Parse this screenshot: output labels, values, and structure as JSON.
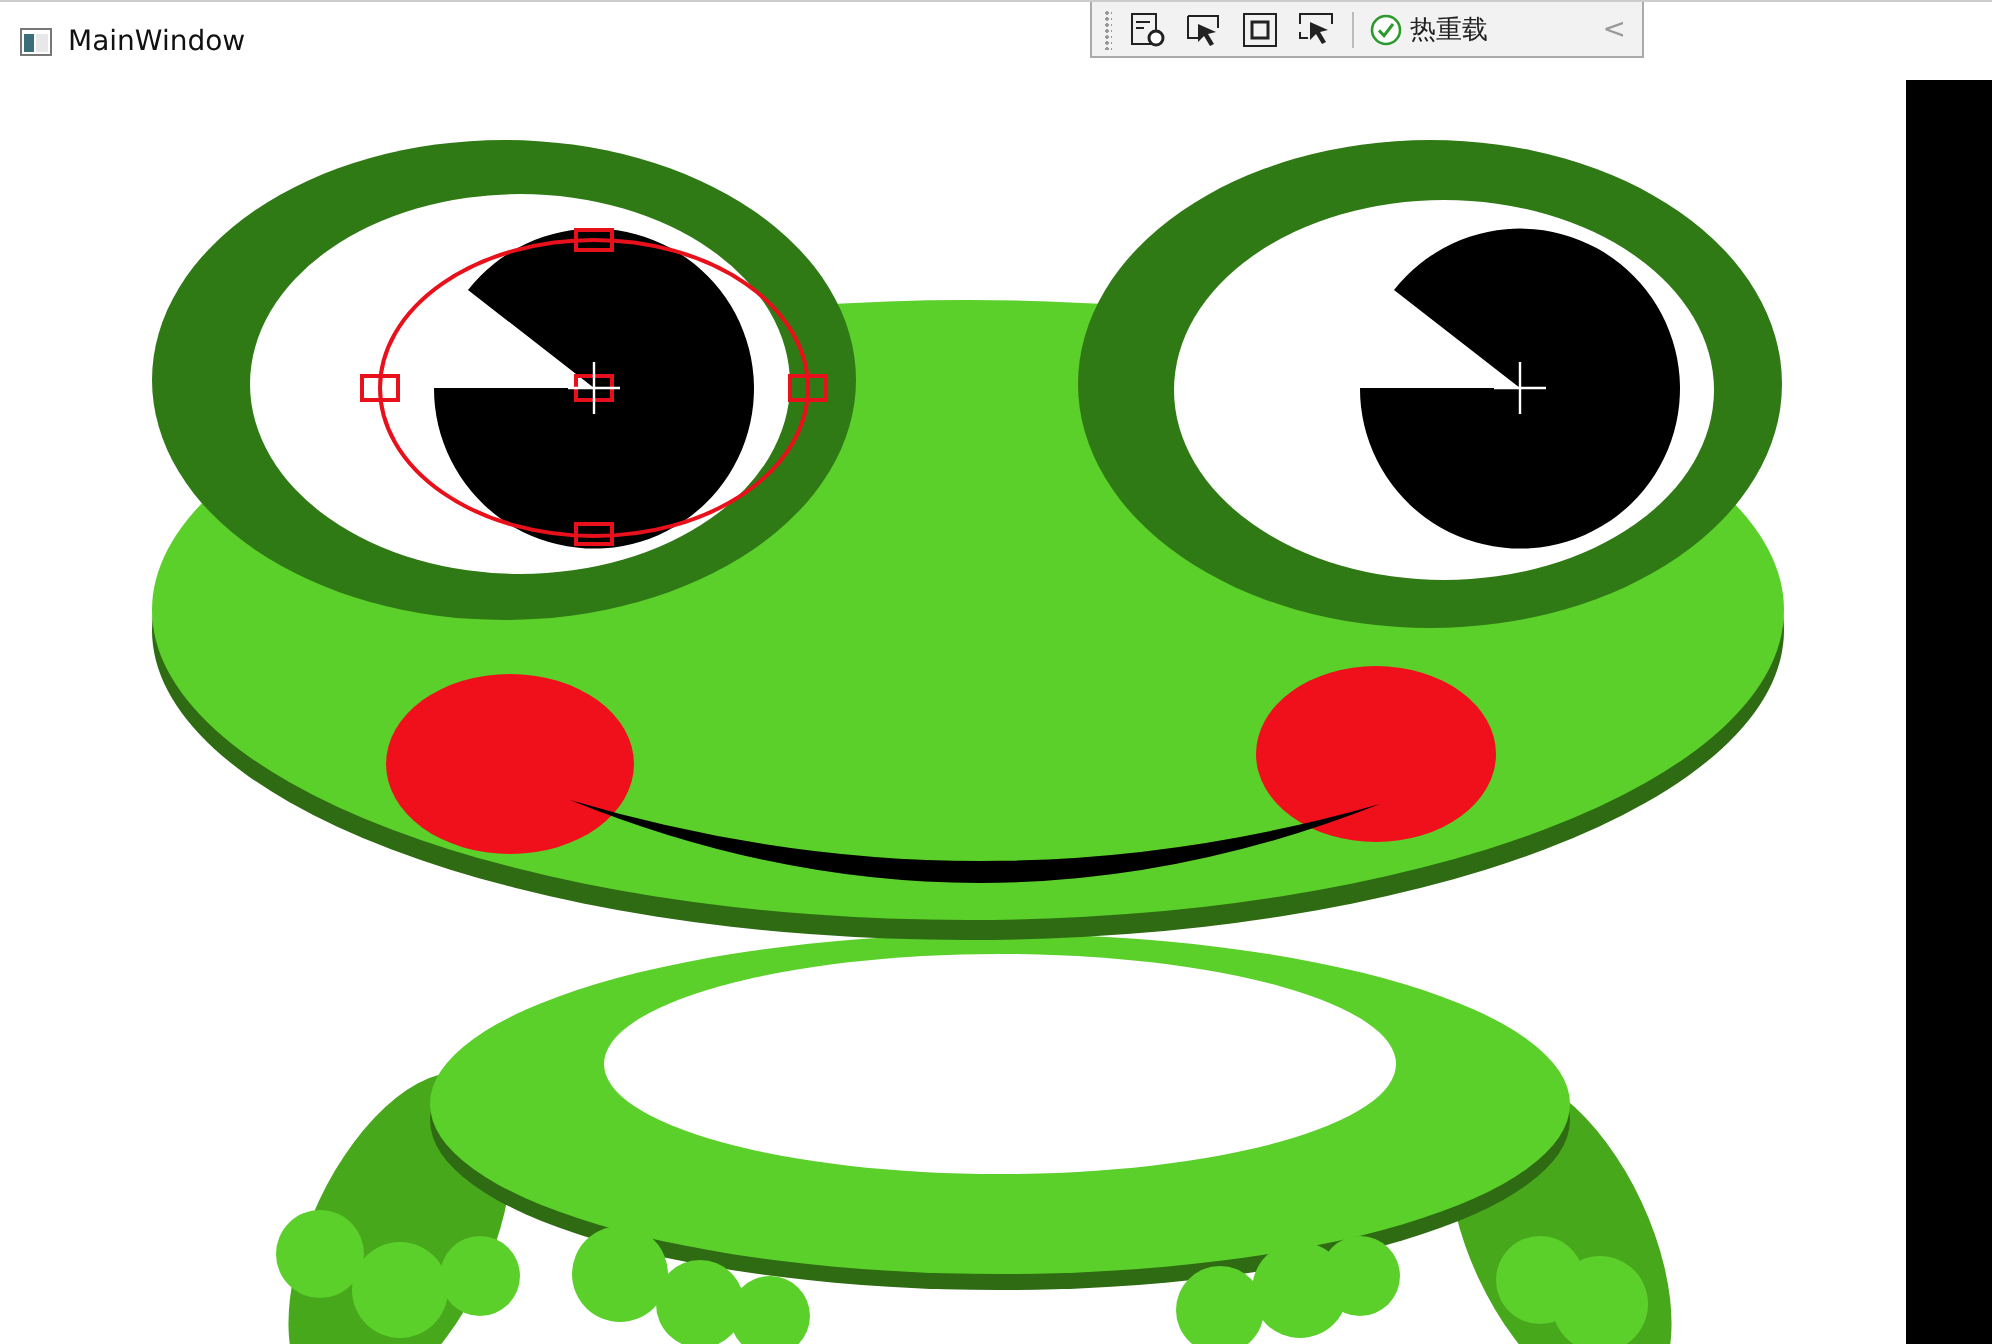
{
  "window": {
    "title": "MainWindow"
  },
  "debug_toolbar": {
    "hot_reload_label": "热重载",
    "collapse_glyph": "<"
  }
}
